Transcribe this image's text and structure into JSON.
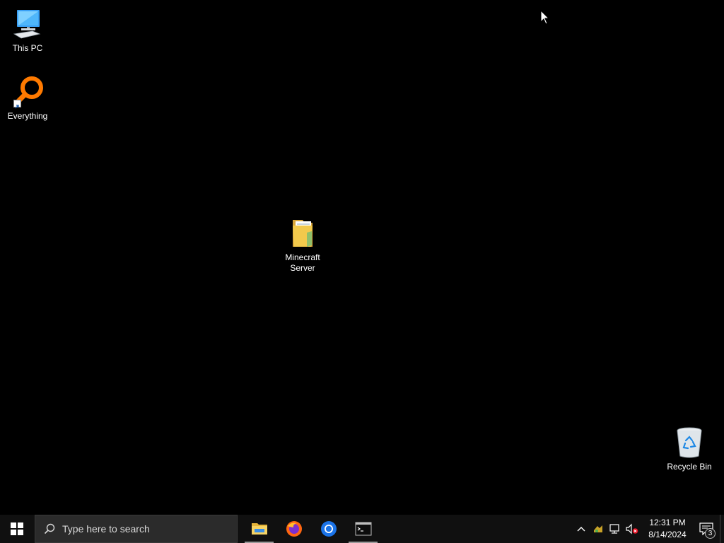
{
  "desktop": {
    "icons": [
      {
        "label": "This PC",
        "icon": "this-pc-icon"
      },
      {
        "label": "Everything",
        "icon": "everything-search-icon"
      },
      {
        "label": "Minecraft Server",
        "icon": "folder-icon"
      },
      {
        "label": "Recycle Bin",
        "icon": "recycle-bin-icon"
      }
    ]
  },
  "taskbar": {
    "search_placeholder": "Type here to search",
    "apps": [
      {
        "name": "File Explorer",
        "icon": "file-explorer-icon",
        "active": true
      },
      {
        "name": "Firefox",
        "icon": "firefox-icon",
        "active": false
      },
      {
        "name": "Chrome",
        "icon": "chrome-icon",
        "active": false
      },
      {
        "name": "Terminal",
        "icon": "terminal-icon",
        "active": true
      }
    ],
    "tray": {
      "time": "12:31 PM",
      "date": "8/14/2024",
      "notification_count": "3"
    }
  },
  "colors": {
    "desktop_bg": "#000000",
    "taskbar_bg": "#101010",
    "search_bg": "#2b2b2b",
    "folder_yellow": "#f2c94c",
    "everything_orange": "#ff7a00",
    "windows_blue": "#4cc2ff"
  }
}
